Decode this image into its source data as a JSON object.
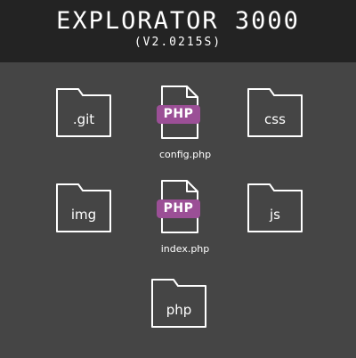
{
  "app": {
    "title": "EXPLORATOR 3000",
    "version": "(V2.0215S)"
  },
  "colors": {
    "background": "#454545",
    "header": "#232323",
    "php_badge": "#9b4f96",
    "icon_stroke": "#ffffff"
  },
  "items": [
    {
      "type": "folder",
      "icon": "folder-icon",
      "label": ".git"
    },
    {
      "type": "file",
      "icon": "php-file-icon",
      "badge": "PHP",
      "label": "config.php"
    },
    {
      "type": "folder",
      "icon": "folder-icon",
      "label": "css"
    },
    {
      "type": "folder",
      "icon": "folder-icon",
      "label": "img"
    },
    {
      "type": "file",
      "icon": "php-file-icon",
      "badge": "PHP",
      "label": "index.php"
    },
    {
      "type": "folder",
      "icon": "folder-icon",
      "label": "js"
    },
    {
      "type": "folder",
      "icon": "folder-icon",
      "label": "php"
    }
  ]
}
